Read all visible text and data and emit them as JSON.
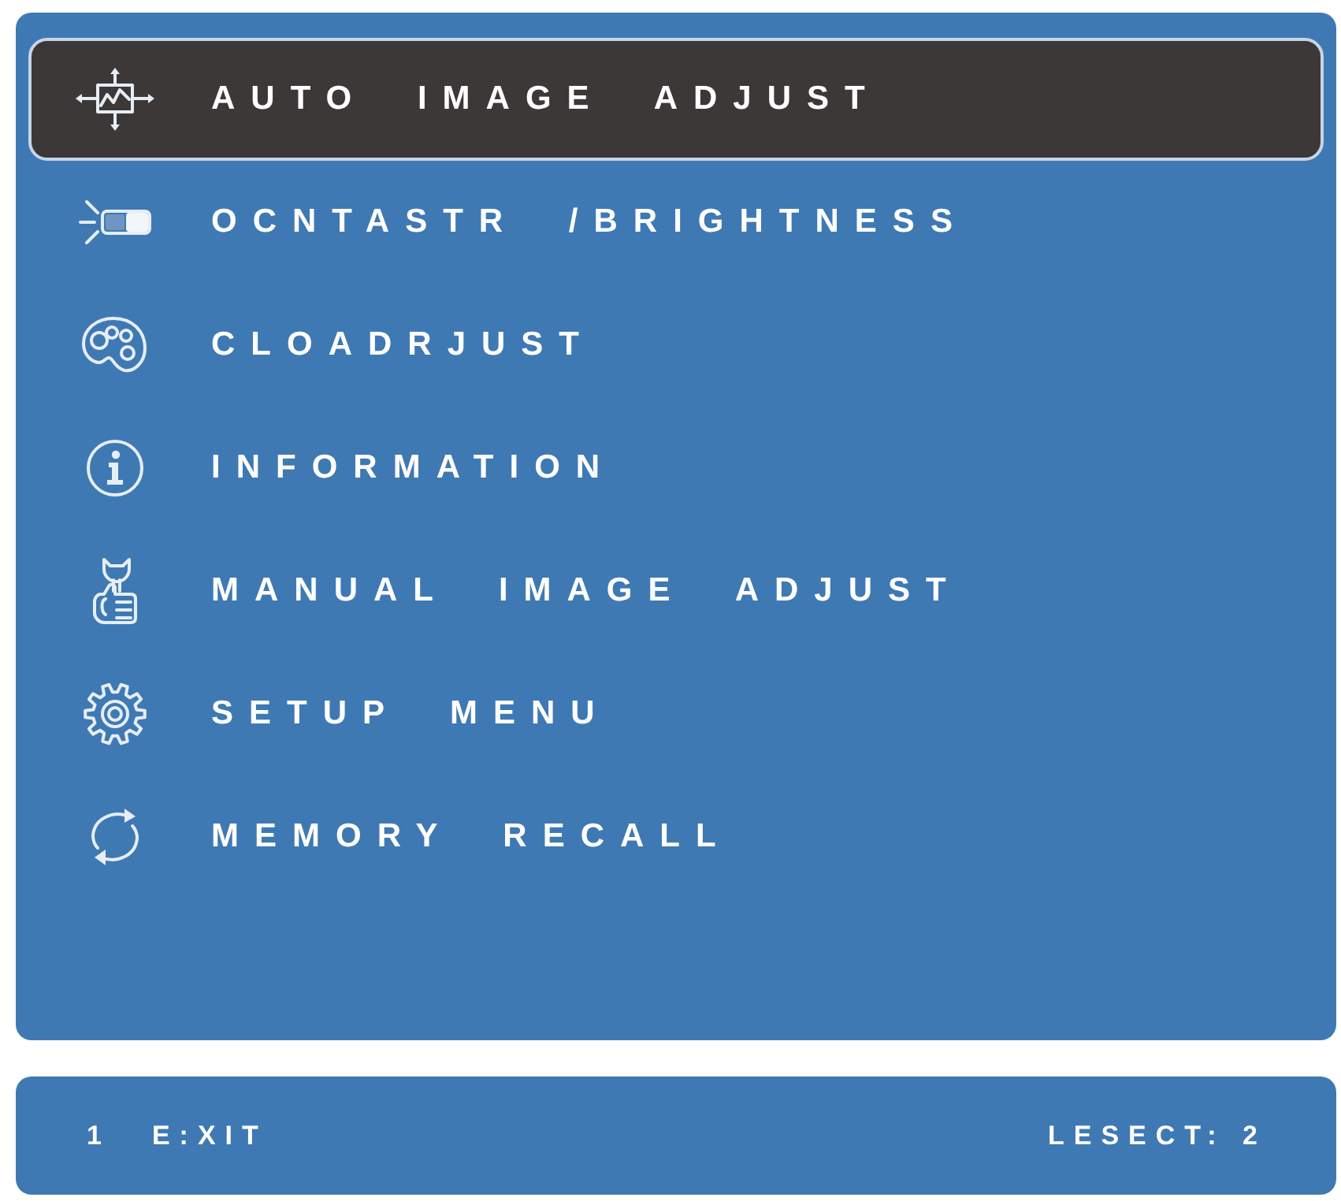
{
  "menu": {
    "items": [
      {
        "label": "AUTO IMAGE ADJUST",
        "kind": "auto-adjust",
        "selected": true
      },
      {
        "label": "OCNTASTR /BRIGHTNESS",
        "kind": "contrast",
        "selected": false
      },
      {
        "label": "CLOADRJUST",
        "kind": "color",
        "selected": false
      },
      {
        "label": "INFORMATION",
        "kind": "info",
        "selected": false
      },
      {
        "label": "MANUAL IMAGE ADJUST",
        "kind": "manual",
        "selected": false
      },
      {
        "label": "SETUP MENU",
        "kind": "setup",
        "selected": false
      },
      {
        "label": "MEMORY RECALL",
        "kind": "recall",
        "selected": false
      }
    ]
  },
  "footer": {
    "exit_key": "1",
    "exit_label": "E:XIT",
    "select_label": "LESECT: 2"
  }
}
